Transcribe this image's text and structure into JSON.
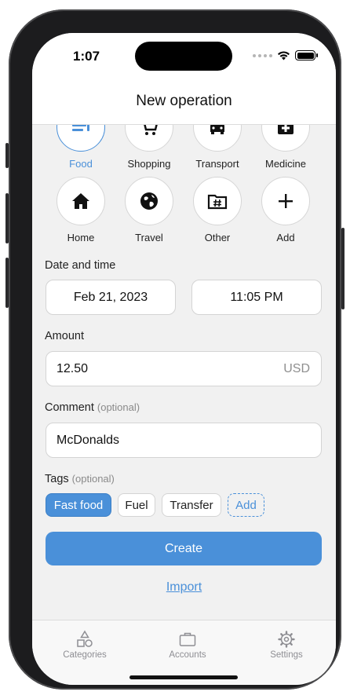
{
  "status_bar": {
    "time": "1:07"
  },
  "header": {
    "title": "New operation"
  },
  "categories": [
    {
      "label": "Food",
      "icon": "food-icon",
      "selected": true
    },
    {
      "label": "Shopping",
      "icon": "shopping-cart-icon",
      "selected": false
    },
    {
      "label": "Transport",
      "icon": "car-icon",
      "selected": false
    },
    {
      "label": "Medicine",
      "icon": "medical-kit-icon",
      "selected": false
    },
    {
      "label": "Home",
      "icon": "home-icon",
      "selected": false
    },
    {
      "label": "Travel",
      "icon": "globe-icon",
      "selected": false
    },
    {
      "label": "Other",
      "icon": "folder-hash-icon",
      "selected": false
    },
    {
      "label": "Add",
      "icon": "plus-icon",
      "selected": false
    }
  ],
  "date_time": {
    "label": "Date and time",
    "date": "Feb 21, 2023",
    "time": "11:05 PM"
  },
  "amount": {
    "label": "Amount",
    "value": "12.50",
    "currency": "USD"
  },
  "comment": {
    "label": "Comment",
    "optional": "(optional)",
    "value": "McDonalds"
  },
  "tags": {
    "label": "Tags",
    "optional": "(optional)",
    "items": [
      {
        "label": "Fast food",
        "active": true
      },
      {
        "label": "Fuel",
        "active": false
      },
      {
        "label": "Transfer",
        "active": false
      }
    ],
    "add_label": "Add"
  },
  "actions": {
    "create_label": "Create",
    "import_label": "Import"
  },
  "tabbar": {
    "items": [
      {
        "label": "Categories",
        "icon": "categories-icon"
      },
      {
        "label": "Accounts",
        "icon": "briefcase-icon"
      },
      {
        "label": "Settings",
        "icon": "gear-icon"
      }
    ]
  },
  "colors": {
    "accent": "#4a90d9",
    "background": "#f1f1f1",
    "device": "#1c1c1e"
  }
}
